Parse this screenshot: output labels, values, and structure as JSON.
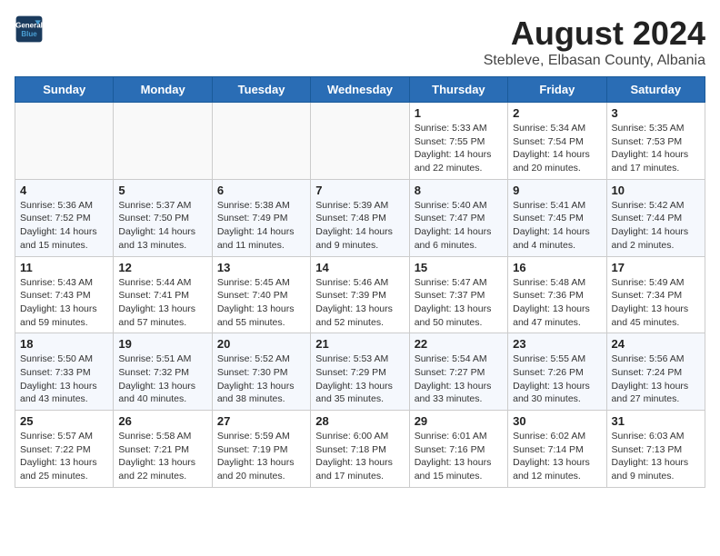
{
  "logo": {
    "line1": "General",
    "line2": "Blue"
  },
  "title": "August 2024",
  "subtitle": "Stebleve, Elbasan County, Albania",
  "days_of_week": [
    "Sunday",
    "Monday",
    "Tuesday",
    "Wednesday",
    "Thursday",
    "Friday",
    "Saturday"
  ],
  "weeks": [
    [
      {
        "num": "",
        "info": ""
      },
      {
        "num": "",
        "info": ""
      },
      {
        "num": "",
        "info": ""
      },
      {
        "num": "",
        "info": ""
      },
      {
        "num": "1",
        "info": "Sunrise: 5:33 AM\nSunset: 7:55 PM\nDaylight: 14 hours\nand 22 minutes."
      },
      {
        "num": "2",
        "info": "Sunrise: 5:34 AM\nSunset: 7:54 PM\nDaylight: 14 hours\nand 20 minutes."
      },
      {
        "num": "3",
        "info": "Sunrise: 5:35 AM\nSunset: 7:53 PM\nDaylight: 14 hours\nand 17 minutes."
      }
    ],
    [
      {
        "num": "4",
        "info": "Sunrise: 5:36 AM\nSunset: 7:52 PM\nDaylight: 14 hours\nand 15 minutes."
      },
      {
        "num": "5",
        "info": "Sunrise: 5:37 AM\nSunset: 7:50 PM\nDaylight: 14 hours\nand 13 minutes."
      },
      {
        "num": "6",
        "info": "Sunrise: 5:38 AM\nSunset: 7:49 PM\nDaylight: 14 hours\nand 11 minutes."
      },
      {
        "num": "7",
        "info": "Sunrise: 5:39 AM\nSunset: 7:48 PM\nDaylight: 14 hours\nand 9 minutes."
      },
      {
        "num": "8",
        "info": "Sunrise: 5:40 AM\nSunset: 7:47 PM\nDaylight: 14 hours\nand 6 minutes."
      },
      {
        "num": "9",
        "info": "Sunrise: 5:41 AM\nSunset: 7:45 PM\nDaylight: 14 hours\nand 4 minutes."
      },
      {
        "num": "10",
        "info": "Sunrise: 5:42 AM\nSunset: 7:44 PM\nDaylight: 14 hours\nand 2 minutes."
      }
    ],
    [
      {
        "num": "11",
        "info": "Sunrise: 5:43 AM\nSunset: 7:43 PM\nDaylight: 13 hours\nand 59 minutes."
      },
      {
        "num": "12",
        "info": "Sunrise: 5:44 AM\nSunset: 7:41 PM\nDaylight: 13 hours\nand 57 minutes."
      },
      {
        "num": "13",
        "info": "Sunrise: 5:45 AM\nSunset: 7:40 PM\nDaylight: 13 hours\nand 55 minutes."
      },
      {
        "num": "14",
        "info": "Sunrise: 5:46 AM\nSunset: 7:39 PM\nDaylight: 13 hours\nand 52 minutes."
      },
      {
        "num": "15",
        "info": "Sunrise: 5:47 AM\nSunset: 7:37 PM\nDaylight: 13 hours\nand 50 minutes."
      },
      {
        "num": "16",
        "info": "Sunrise: 5:48 AM\nSunset: 7:36 PM\nDaylight: 13 hours\nand 47 minutes."
      },
      {
        "num": "17",
        "info": "Sunrise: 5:49 AM\nSunset: 7:34 PM\nDaylight: 13 hours\nand 45 minutes."
      }
    ],
    [
      {
        "num": "18",
        "info": "Sunrise: 5:50 AM\nSunset: 7:33 PM\nDaylight: 13 hours\nand 43 minutes."
      },
      {
        "num": "19",
        "info": "Sunrise: 5:51 AM\nSunset: 7:32 PM\nDaylight: 13 hours\nand 40 minutes."
      },
      {
        "num": "20",
        "info": "Sunrise: 5:52 AM\nSunset: 7:30 PM\nDaylight: 13 hours\nand 38 minutes."
      },
      {
        "num": "21",
        "info": "Sunrise: 5:53 AM\nSunset: 7:29 PM\nDaylight: 13 hours\nand 35 minutes."
      },
      {
        "num": "22",
        "info": "Sunrise: 5:54 AM\nSunset: 7:27 PM\nDaylight: 13 hours\nand 33 minutes."
      },
      {
        "num": "23",
        "info": "Sunrise: 5:55 AM\nSunset: 7:26 PM\nDaylight: 13 hours\nand 30 minutes."
      },
      {
        "num": "24",
        "info": "Sunrise: 5:56 AM\nSunset: 7:24 PM\nDaylight: 13 hours\nand 27 minutes."
      }
    ],
    [
      {
        "num": "25",
        "info": "Sunrise: 5:57 AM\nSunset: 7:22 PM\nDaylight: 13 hours\nand 25 minutes."
      },
      {
        "num": "26",
        "info": "Sunrise: 5:58 AM\nSunset: 7:21 PM\nDaylight: 13 hours\nand 22 minutes."
      },
      {
        "num": "27",
        "info": "Sunrise: 5:59 AM\nSunset: 7:19 PM\nDaylight: 13 hours\nand 20 minutes."
      },
      {
        "num": "28",
        "info": "Sunrise: 6:00 AM\nSunset: 7:18 PM\nDaylight: 13 hours\nand 17 minutes."
      },
      {
        "num": "29",
        "info": "Sunrise: 6:01 AM\nSunset: 7:16 PM\nDaylight: 13 hours\nand 15 minutes."
      },
      {
        "num": "30",
        "info": "Sunrise: 6:02 AM\nSunset: 7:14 PM\nDaylight: 13 hours\nand 12 minutes."
      },
      {
        "num": "31",
        "info": "Sunrise: 6:03 AM\nSunset: 7:13 PM\nDaylight: 13 hours\nand 9 minutes."
      }
    ]
  ]
}
